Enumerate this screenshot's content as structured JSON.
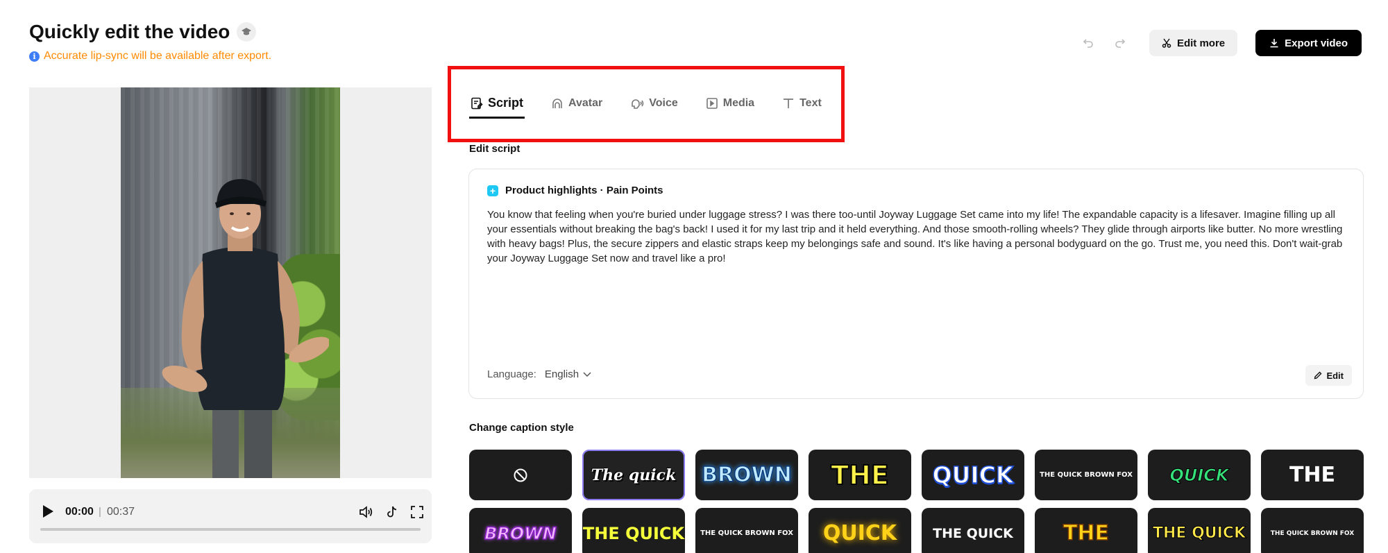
{
  "header": {
    "title": "Quickly edit the video",
    "notice": "Accurate lip-sync will be available after export.",
    "edit_more_label": "Edit more",
    "export_label": "Export video"
  },
  "player": {
    "current_time": "00:00",
    "total_time": "00:37",
    "progress": 0
  },
  "tabs": [
    {
      "label": "Script",
      "icon": "script-icon",
      "active": true
    },
    {
      "label": "Avatar",
      "icon": "avatar-icon",
      "active": false
    },
    {
      "label": "Voice",
      "icon": "voice-icon",
      "active": false
    },
    {
      "label": "Media",
      "icon": "media-icon",
      "active": false
    },
    {
      "label": "Text",
      "icon": "text-icon",
      "active": false
    }
  ],
  "script": {
    "section_label": "Edit script",
    "card_title": "Product highlights · Pain Points",
    "body": "You know that feeling when you're buried under luggage stress? I was there too-until Joyway Luggage Set came into my life! The expandable capacity is a lifesaver. Imagine filling up all your essentials without breaking the bag's back! I used it for my last trip and it held everything. And those smooth-rolling wheels? They glide through airports like butter. No more wrestling with heavy bags! Plus, the secure zippers and elastic straps keep my belongings safe and sound. It's like having a personal bodyguard on the go. Trust me, you need this. Don't wait-grab your Joyway Luggage Set now and travel like a pro!",
    "language_label": "Language:",
    "language_value": "English",
    "edit_label": "Edit"
  },
  "captions": {
    "section_label": "Change caption style",
    "selected_index": 1,
    "styles": [
      {
        "text": "",
        "icon": "none-icon"
      },
      {
        "text": "The quick"
      },
      {
        "text": "BROWN"
      },
      {
        "text": "THE"
      },
      {
        "text": "QUICK"
      },
      {
        "text": "THE QUICK BROWN FOX"
      },
      {
        "text": "QUICK"
      },
      {
        "text": "THE"
      },
      {
        "text": "BROWN"
      },
      {
        "text": "THE QUICK"
      },
      {
        "text": "THE QUICK BROWN FOX"
      },
      {
        "text": "QUICK"
      },
      {
        "text": "THE QUICK"
      },
      {
        "text": "THE"
      },
      {
        "text": "THE QUICK"
      },
      {
        "text": "THE QUICK BROWN FOX"
      }
    ]
  },
  "colors": {
    "accent_highlight": "#f20f0f",
    "notice": "#ff8a00",
    "info_icon": "#3d7ef8",
    "selected_outline": "#8a7cf0"
  }
}
